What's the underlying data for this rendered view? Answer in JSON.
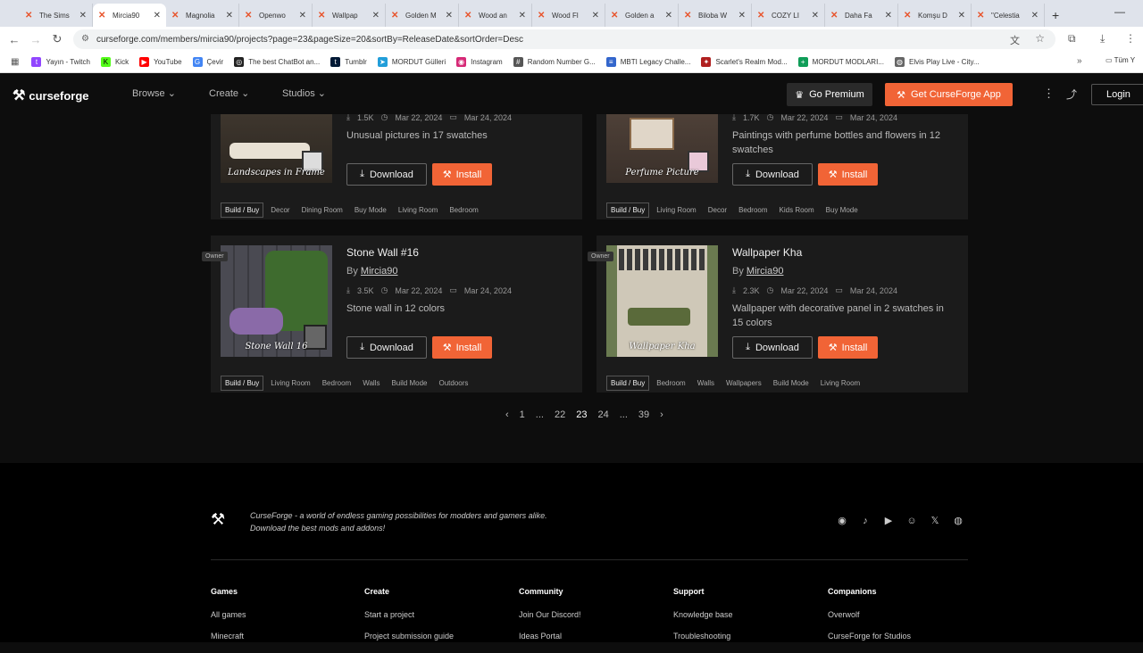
{
  "browser": {
    "tabs": [
      {
        "label": "The Sims"
      },
      {
        "label": "Mircia90"
      },
      {
        "label": "Magnolia"
      },
      {
        "label": "Openwo"
      },
      {
        "label": "Wallpap"
      },
      {
        "label": "Golden M"
      },
      {
        "label": "Wood an"
      },
      {
        "label": "Wood Fl"
      },
      {
        "label": "Golden a"
      },
      {
        "label": "Biloba W"
      },
      {
        "label": "COZY LI"
      },
      {
        "label": "Daha Fa"
      },
      {
        "label": "Komşu D"
      },
      {
        "label": "\"Celestia"
      }
    ],
    "url": "curseforge.com/members/mircia90/projects?page=23&pageSize=20&sortBy=ReleaseDate&sortOrder=Desc",
    "bookmarks": [
      {
        "label": "Yayın - Twitch"
      },
      {
        "label": "Kick"
      },
      {
        "label": "YouTube"
      },
      {
        "label": "Çevir"
      },
      {
        "label": "The best ChatBot an..."
      },
      {
        "label": "Tumblr"
      },
      {
        "label": "MORDUT Gülleri"
      },
      {
        "label": "Instagram"
      },
      {
        "label": "Random Number G..."
      },
      {
        "label": "MBTI Legacy Challe..."
      },
      {
        "label": "Scarlet's Realm Mod..."
      },
      {
        "label": "MORDUT MODLARI..."
      },
      {
        "label": "Elvis Play Live - City..."
      }
    ],
    "all_bookmarks": "Tüm Y"
  },
  "header": {
    "brand": "curseforge",
    "nav": [
      "Browse",
      "Create",
      "Studios"
    ],
    "premium": "Go Premium",
    "get_app": "Get CurseForge App",
    "login": "Login"
  },
  "cards": [
    {
      "title": "",
      "thumb_label": "Landscapes in Frame",
      "downloads": "1.5K",
      "created": "Mar 22, 2024",
      "updated": "Mar 24, 2024",
      "desc": "Unusual pictures in 17 swatches",
      "download": "Download",
      "install": "Install",
      "tag_main": "Build / Buy",
      "tags": [
        "Decor",
        "Dining Room",
        "Buy Mode",
        "Living Room",
        "Bedroom"
      ]
    },
    {
      "title": "",
      "thumb_label": "Perfume Picture",
      "downloads": "1.7K",
      "created": "Mar 22, 2024",
      "updated": "Mar 24, 2024",
      "desc": "Paintings with perfume bottles and flowers in 12 swatches",
      "download": "Download",
      "install": "Install",
      "tag_main": "Build / Buy",
      "tags": [
        "Living Room",
        "Decor",
        "Bedroom",
        "Kids Room",
        "Buy Mode"
      ]
    },
    {
      "title": "Stone Wall #16",
      "owner": "Owner",
      "by": "By",
      "author": "Mircia90",
      "thumb_label": "Stone Wall 16",
      "downloads": "3.5K",
      "created": "Mar 22, 2024",
      "updated": "Mar 24, 2024",
      "desc": "Stone wall in 12 colors",
      "download": "Download",
      "install": "Install",
      "tag_main": "Build / Buy",
      "tags": [
        "Living Room",
        "Bedroom",
        "Walls",
        "Build Mode",
        "Outdoors"
      ]
    },
    {
      "title": "Wallpaper Kha",
      "owner": "Owner",
      "by": "By",
      "author": "Mircia90",
      "thumb_label": "Wallpaper Kha",
      "downloads": "2.3K",
      "created": "Mar 22, 2024",
      "updated": "Mar 24, 2024",
      "desc": "Wallpaper with decorative panel in 2 swatches in 15 colors",
      "download": "Download",
      "install": "Install",
      "tag_main": "Build / Buy",
      "tags": [
        "Bedroom",
        "Walls",
        "Wallpapers",
        "Build Mode",
        "Living Room"
      ]
    }
  ],
  "pagination": {
    "prev": "‹",
    "pages": [
      "1",
      "...",
      "22",
      "23",
      "24",
      "...",
      "39"
    ],
    "current": "23",
    "next": "›"
  },
  "footer": {
    "tagline_1": "CurseForge - a world of endless gaming possibilities for modders and gamers alike.",
    "tagline_2": "Download the best mods and addons!",
    "columns": [
      {
        "heading": "Games",
        "links": [
          "All games",
          "Minecraft"
        ]
      },
      {
        "heading": "Create",
        "links": [
          "Start a project",
          "Project submission guide"
        ]
      },
      {
        "heading": "Community",
        "links": [
          "Join Our Discord!",
          "Ideas Portal"
        ]
      },
      {
        "heading": "Support",
        "links": [
          "Knowledge base",
          "Troubleshooting"
        ]
      },
      {
        "heading": "Companions",
        "links": [
          "Overwolf",
          "CurseForge for Studios"
        ]
      }
    ]
  }
}
